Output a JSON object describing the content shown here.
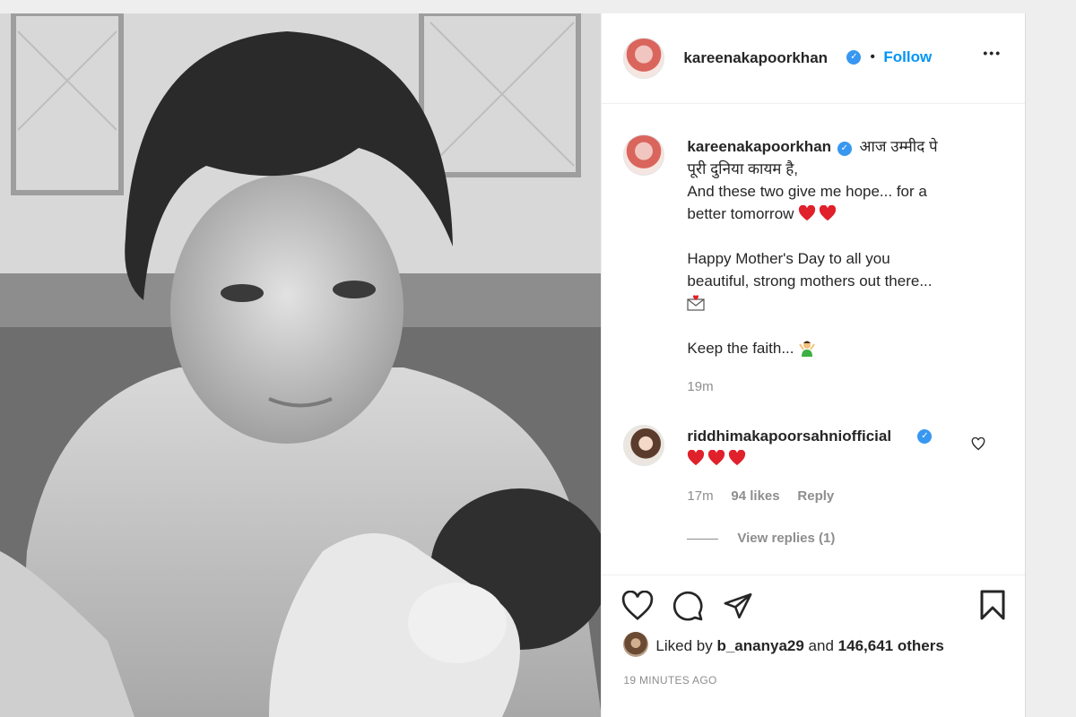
{
  "post": {
    "username": "kareenakapoorkhan",
    "follow_label": "Follow",
    "separator": "•",
    "more_label": "•••"
  },
  "caption": {
    "username": "kareenakapoorkhan",
    "line1": "आज उम्मीद पे",
    "line2": "पूरी दुनिया कायम है,",
    "line3": "And these two give me hope... for a",
    "line4": "better tomorrow",
    "line5": "Happy Mother's Day to all you",
    "line6": "beautiful, strong mothers out there...",
    "line7": "Keep the faith...",
    "time": "19m"
  },
  "comment": {
    "username": "riddhimakapoorsahniofficial",
    "time": "17m",
    "likes": "94 likes",
    "reply_label": "Reply",
    "view_replies": "View replies (1)"
  },
  "footer": {
    "liked_prefix": "Liked by",
    "liked_user": "b_ananya29",
    "liked_and": "and",
    "liked_others": "146,641 others",
    "timestamp": "19 MINUTES AGO"
  },
  "icons": {
    "like": "heart-outline-icon",
    "comment": "comment-bubble-icon",
    "share": "paper-plane-icon",
    "save": "bookmark-icon",
    "verified": "verified-badge-icon",
    "more": "more-options-icon"
  },
  "colors": {
    "accent": "#0095f6",
    "verified": "#3897f0",
    "heart_red": "#e0202a",
    "muted": "#8e8e8e"
  }
}
